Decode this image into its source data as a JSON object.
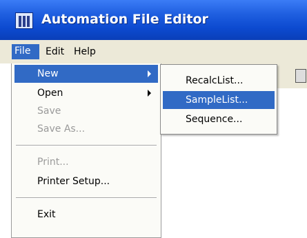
{
  "window": {
    "title": "Automation File Editor"
  },
  "menubar": {
    "file": "File",
    "edit": "Edit",
    "help": "Help"
  },
  "file_menu": {
    "items": [
      {
        "label": "New",
        "state": "highlighted",
        "submenu": true
      },
      {
        "label": "Open",
        "state": "enabled",
        "submenu": true
      },
      {
        "label": "Save",
        "state": "disabled"
      },
      {
        "label": "Save As...",
        "state": "disabled"
      },
      {
        "label": "Print...",
        "state": "disabled"
      },
      {
        "label": "Printer Setup...",
        "state": "enabled"
      },
      {
        "label": "Exit",
        "state": "enabled"
      }
    ]
  },
  "new_submenu": {
    "items": [
      {
        "label": "RecalcList...",
        "state": "enabled"
      },
      {
        "label": "SampleList...",
        "state": "highlighted"
      },
      {
        "label": "Sequence...",
        "state": "enabled"
      }
    ]
  },
  "colors": {
    "highlight": "#316ac5",
    "titlebar": "#0c4ad0",
    "menubar": "#ece9d8",
    "disabled_text": "#9a9a9a"
  }
}
